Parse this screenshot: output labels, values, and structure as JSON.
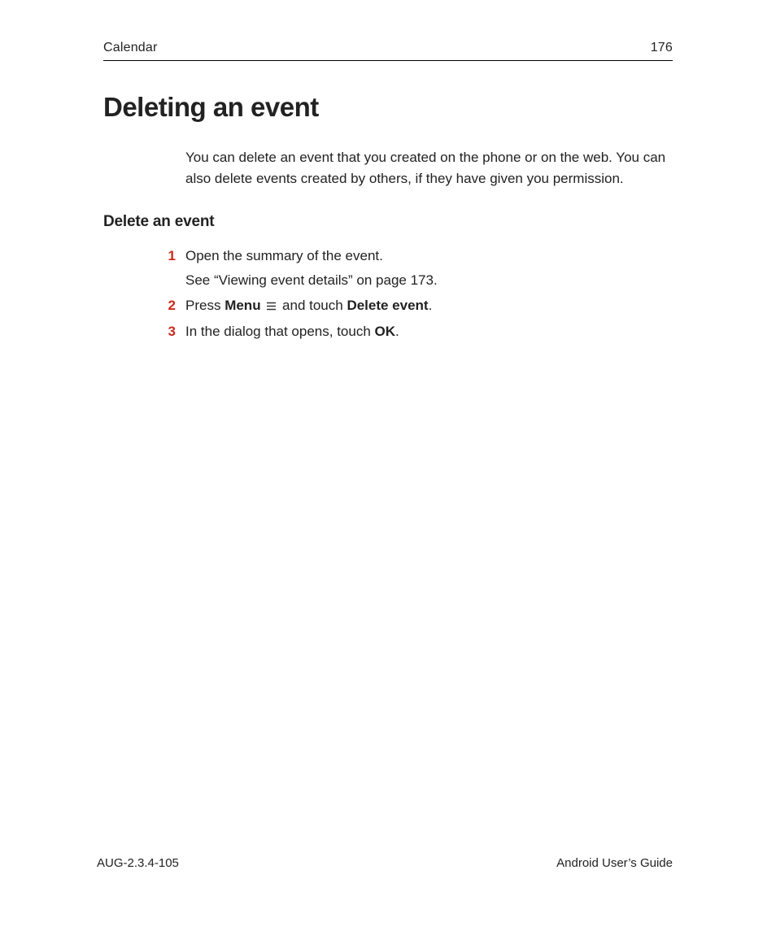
{
  "header": {
    "section": "Calendar",
    "page_num": "176"
  },
  "title": "Deleting an event",
  "intro": "You can delete an event that you created on the phone or on the web. You can also delete events created by others, if they have given you permission.",
  "subheading": "Delete an event",
  "steps": {
    "s1": {
      "num": "1",
      "line1": "Open the summary of the event.",
      "line2": "See “Viewing event details” on page 173."
    },
    "s2": {
      "num": "2",
      "pre": "Press ",
      "menu_word": "Menu",
      "mid": " and touch ",
      "action_word": "Delete event",
      "post": "."
    },
    "s3": {
      "num": "3",
      "pre": "In the dialog that opens, touch ",
      "ok_word": "OK",
      "post": "."
    }
  },
  "footer": {
    "left": "AUG-2.3.4-105",
    "right": "Android User’s Guide"
  }
}
